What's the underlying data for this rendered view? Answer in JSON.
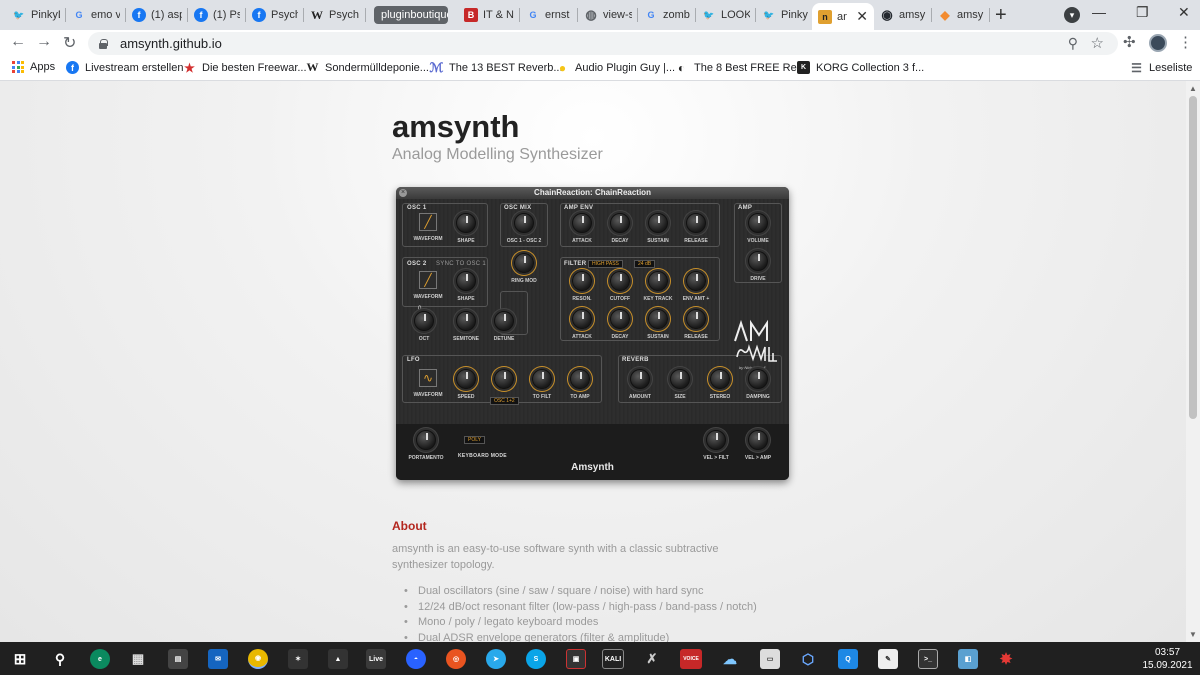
{
  "browser": {
    "tabs": [
      {
        "title": "PinkyD",
        "icon": "twitter-icon",
        "color": "#1d9bf0",
        "glyph": "🐦"
      },
      {
        "title": "emo v",
        "icon": "google-icon",
        "color": "#ffffff",
        "glyph": "G"
      },
      {
        "title": "(1) asp",
        "icon": "facebook-icon",
        "color": "#1877f2",
        "glyph": "f"
      },
      {
        "title": "(1) Psy",
        "icon": "facebook-icon",
        "color": "#1877f2",
        "glyph": "f"
      },
      {
        "title": "Psyche",
        "icon": "facebook-icon",
        "color": "#1877f2",
        "glyph": "f"
      },
      {
        "title": "Psych",
        "icon": "wikipedia-icon",
        "color": "#ffffff",
        "glyph": "W"
      },
      {
        "title": "pluginboutique",
        "icon": "",
        "color": "",
        "glyph": ""
      },
      {
        "title": "IT & N",
        "icon": "b-icon",
        "color": "#c62828",
        "glyph": "B"
      },
      {
        "title": "ernst l",
        "icon": "google-icon",
        "color": "#ffffff",
        "glyph": "G"
      },
      {
        "title": "view-s",
        "icon": "globe-icon",
        "color": "#5f6368",
        "glyph": "◍"
      },
      {
        "title": "zomb",
        "icon": "google-icon",
        "color": "#ffffff",
        "glyph": "G"
      },
      {
        "title": "LOOK",
        "icon": "twitter-icon",
        "color": "#1d9bf0",
        "glyph": "🐦"
      },
      {
        "title": "PinkyD",
        "icon": "twitter-icon",
        "color": "#1d9bf0",
        "glyph": "🐦"
      },
      {
        "title": "an",
        "icon": "amsynth-icon",
        "color": "#e0a030",
        "glyph": "n"
      },
      {
        "title": "amsyn",
        "icon": "github-icon",
        "color": "#24292f",
        "glyph": "◉"
      },
      {
        "title": "amsyn",
        "icon": "diamond-icon",
        "color": "#f28b30",
        "glyph": "◆"
      }
    ],
    "active_tab_close": "✕",
    "new_tab": "+",
    "window_controls": {
      "minimize": "—",
      "restore": "❐",
      "close": "✕"
    },
    "url": "amsynth.github.io",
    "bookmarks": [
      {
        "label": "Apps",
        "icon": "apps-grid-icon"
      },
      {
        "label": "Livestream erstellen",
        "icon": "facebook-icon",
        "color": "#1877f2",
        "glyph": "f"
      },
      {
        "label": "Die besten Freewar...",
        "icon": "star-icon",
        "color": "#d32f2f",
        "glyph": "★"
      },
      {
        "label": "Sondermülldeponie...",
        "icon": "wikipedia-icon",
        "color": "#222222",
        "glyph": "W"
      },
      {
        "label": "The 13 BEST Reverb...",
        "icon": "k-logo-icon",
        "color": "#5a6ad0",
        "glyph": "ℳ"
      },
      {
        "label": "Audio Plugin Guy |...",
        "icon": "plugin-guy-icon",
        "color": "#f5c518",
        "glyph": "●"
      },
      {
        "label": "The 8 Best FREE Re...",
        "icon": "moon-icon",
        "color": "#222222",
        "glyph": "◐"
      },
      {
        "label": "KORG Collection 3 f...",
        "icon": "korg-icon",
        "color": "#222222",
        "glyph": "K"
      }
    ],
    "reading_list": "Leseliste"
  },
  "page": {
    "title": "amsynth",
    "subtitle": "Analog Modelling Synthesizer",
    "synth": {
      "window_title": "ChainReaction: ChainReaction",
      "sections": {
        "osc1": "OSC 1",
        "osc_mix": "OSC MIX",
        "amp_env": "AMP ENV",
        "amp": "AMP",
        "osc2": "OSC 2",
        "sync": "SYNC TO OSC 1",
        "filter": "FILTER",
        "lfo": "LFO",
        "reverb": "REVERB"
      },
      "labels": {
        "waveform": "WAVEFORM",
        "shape": "SHAPE",
        "osc_mix": "OSC 1 - OSC 2",
        "ring_mod": "RING MOD",
        "attack": "ATTACK",
        "decay": "DECAY",
        "sustain": "SUSTAIN",
        "release": "RELEASE",
        "volume": "VOLUME",
        "drive": "DRIVE",
        "reson": "RESON.",
        "cutoff": "CUTOFF",
        "key_track": "KEY TRACK",
        "env_amt": "ENV AMT +",
        "oct": "OCT",
        "semitone": "SEMITONE",
        "detune": "DETUNE",
        "speed": "SPEED",
        "to_filt": "TO FILT",
        "to_amp": "TO AMP",
        "amount": "AMOUNT",
        "size": "SIZE",
        "stereo": "STEREO",
        "damping": "DAMPING",
        "portamento": "PORTAMENTO",
        "keyboard_mode": "KEYBOARD MODE",
        "vel_filt": "VEL > FILT",
        "vel_amp": "VEL > AMP"
      },
      "filter_type": "HIGH PASS",
      "filter_slope": "24 dB",
      "lfo_dest": "OSC 1+2",
      "keyboard_mode_value": "POLY",
      "octave_value": "0",
      "logo_byline": "by Nick Dowell",
      "name": "Amsynth"
    },
    "about_heading": "About",
    "about_text": "amsynth is an easy-to-use software synth with a classic subtractive synthesizer topology.",
    "features": [
      "Dual oscillators (sine / saw / square / noise) with hard sync",
      "12/24 dB/oct resonant filter (low-pass / high-pass / band-pass / notch)",
      "Mono / poly / legato keyboard modes",
      "Dual ADSR envelope generators (filter & amplitude)"
    ]
  },
  "taskbar": {
    "time": "03:57",
    "date": "15.09.2021"
  }
}
